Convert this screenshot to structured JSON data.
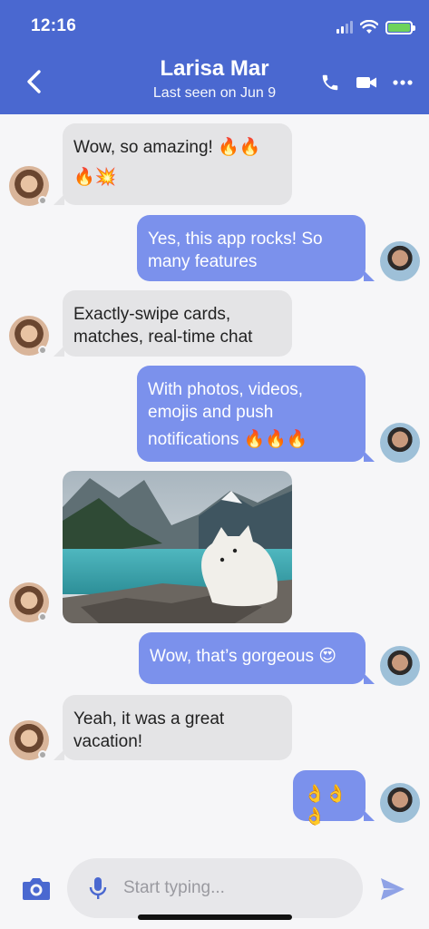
{
  "status_bar": {
    "time": "12:16"
  },
  "header": {
    "name": "Larisa Mar",
    "subtitle": "Last seen on Jun 9",
    "icons": [
      "back-chevron-icon",
      "phone-icon",
      "video-camera-icon",
      "more-dots-icon"
    ]
  },
  "messages": [
    {
      "from": "them",
      "line1": "Wow, so amazing! 🔥🔥",
      "line2": "🔥💥"
    },
    {
      "from": "me",
      "line1": "Yes, this app rocks! So",
      "line2": "many features"
    },
    {
      "from": "them",
      "line1": "Exactly-swipe cards,",
      "line2": "matches, real-time chat"
    },
    {
      "from": "me",
      "line1": "With photos, videos,",
      "line2": "emojis and push",
      "line3": "notifications 🔥🔥🔥"
    },
    {
      "from": "them",
      "type": "photo"
    },
    {
      "from": "me",
      "line1": "Wow, that’s gorgeous 😍"
    },
    {
      "from": "them",
      "line1": "Yeah, it was a great",
      "line2": "vacation!"
    },
    {
      "from": "me",
      "line1": "👌👌👌"
    }
  ],
  "composer": {
    "placeholder": "Start typing...",
    "icons": [
      "camera-icon",
      "microphone-icon",
      "send-icon"
    ]
  },
  "colors": {
    "header_bg": "#4a68d0",
    "outgoing_bubble": "#7b91ec",
    "incoming_bubble": "#e4e4e6",
    "background": "#f6f6f8"
  }
}
